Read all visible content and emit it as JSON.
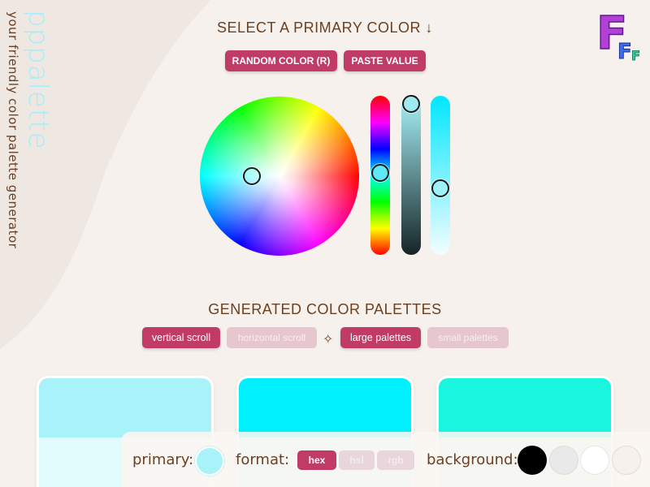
{
  "brand": {
    "name": "pppalette",
    "tagline": "your friendly color palette generator",
    "logo_letters": [
      "F",
      "F",
      "F"
    ]
  },
  "picker": {
    "heading": "SELECT A PRIMARY COLOR ↓",
    "random_label": "RANDOM COLOR (R)",
    "paste_label": "PASTE VALUE"
  },
  "palettes": {
    "heading": "GENERATED COLOR PALETTES",
    "options": [
      "vertical scroll",
      "horizontal scroll",
      "large palettes",
      "small palettes"
    ],
    "active": [
      "vertical scroll",
      "large palettes"
    ],
    "separator_icon": "✧",
    "cards": [
      {
        "top": "#a8f2fa",
        "bottom": "#e2fcfd"
      },
      {
        "top": "#00f0ff",
        "bottom": "#c8fbfd"
      },
      {
        "top": "#1af5e0",
        "bottom": "#d0fbf6"
      }
    ]
  },
  "bottom_bar": {
    "primary_label": "primary:",
    "primary_color": "#a8f3fa",
    "format_label": "format:",
    "formats": [
      "hex",
      "hsl",
      "rgb"
    ],
    "active_format": "hex",
    "background_label": "background:",
    "backgrounds": [
      "#000000",
      "#e9e9e9",
      "#ffffff",
      "#f6f1ec"
    ]
  },
  "colors": {
    "accent": "#c03c67",
    "accent_muted": "#e7c7cf",
    "text": "#6b3f1f",
    "page_bg": "#f6f1ec"
  }
}
